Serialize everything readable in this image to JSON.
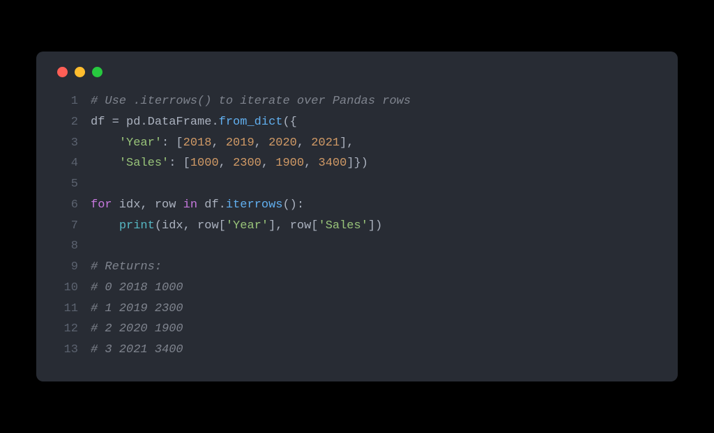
{
  "lines": [
    {
      "n": "1",
      "tokens": [
        {
          "c": "tok-comment",
          "t": "# Use .iterrows() to iterate over Pandas rows"
        }
      ]
    },
    {
      "n": "2",
      "tokens": [
        {
          "c": "tok-name",
          "t": "df "
        },
        {
          "c": "tok-op",
          "t": "= "
        },
        {
          "c": "tok-name",
          "t": "pd"
        },
        {
          "c": "tok-punct",
          "t": "."
        },
        {
          "c": "tok-name",
          "t": "DataFrame"
        },
        {
          "c": "tok-punct",
          "t": "."
        },
        {
          "c": "tok-attr",
          "t": "from_dict"
        },
        {
          "c": "tok-punct",
          "t": "({"
        }
      ]
    },
    {
      "n": "3",
      "tokens": [
        {
          "c": "",
          "t": "    "
        },
        {
          "c": "tok-string",
          "t": "'Year'"
        },
        {
          "c": "tok-punct",
          "t": ": ["
        },
        {
          "c": "tok-number",
          "t": "2018"
        },
        {
          "c": "tok-punct",
          "t": ", "
        },
        {
          "c": "tok-number",
          "t": "2019"
        },
        {
          "c": "tok-punct",
          "t": ", "
        },
        {
          "c": "tok-number",
          "t": "2020"
        },
        {
          "c": "tok-punct",
          "t": ", "
        },
        {
          "c": "tok-number",
          "t": "2021"
        },
        {
          "c": "tok-punct",
          "t": "],"
        }
      ]
    },
    {
      "n": "4",
      "tokens": [
        {
          "c": "",
          "t": "    "
        },
        {
          "c": "tok-string",
          "t": "'Sales'"
        },
        {
          "c": "tok-punct",
          "t": ": ["
        },
        {
          "c": "tok-number",
          "t": "1000"
        },
        {
          "c": "tok-punct",
          "t": ", "
        },
        {
          "c": "tok-number",
          "t": "2300"
        },
        {
          "c": "tok-punct",
          "t": ", "
        },
        {
          "c": "tok-number",
          "t": "1900"
        },
        {
          "c": "tok-punct",
          "t": ", "
        },
        {
          "c": "tok-number",
          "t": "3400"
        },
        {
          "c": "tok-punct",
          "t": "]})"
        }
      ]
    },
    {
      "n": "5",
      "tokens": []
    },
    {
      "n": "6",
      "tokens": [
        {
          "c": "tok-keyword",
          "t": "for"
        },
        {
          "c": "tok-name",
          "t": " idx"
        },
        {
          "c": "tok-punct",
          "t": ", "
        },
        {
          "c": "tok-name",
          "t": "row "
        },
        {
          "c": "tok-keyword",
          "t": "in"
        },
        {
          "c": "tok-name",
          "t": " df"
        },
        {
          "c": "tok-punct",
          "t": "."
        },
        {
          "c": "tok-attr",
          "t": "iterrows"
        },
        {
          "c": "tok-punct",
          "t": "():"
        }
      ]
    },
    {
      "n": "7",
      "tokens": [
        {
          "c": "",
          "t": "    "
        },
        {
          "c": "tok-builtin",
          "t": "print"
        },
        {
          "c": "tok-punct",
          "t": "("
        },
        {
          "c": "tok-name",
          "t": "idx"
        },
        {
          "c": "tok-punct",
          "t": ", "
        },
        {
          "c": "tok-name",
          "t": "row"
        },
        {
          "c": "tok-punct",
          "t": "["
        },
        {
          "c": "tok-string",
          "t": "'Year'"
        },
        {
          "c": "tok-punct",
          "t": "], "
        },
        {
          "c": "tok-name",
          "t": "row"
        },
        {
          "c": "tok-punct",
          "t": "["
        },
        {
          "c": "tok-string",
          "t": "'Sales'"
        },
        {
          "c": "tok-punct",
          "t": "])"
        }
      ]
    },
    {
      "n": "8",
      "tokens": []
    },
    {
      "n": "9",
      "tokens": [
        {
          "c": "tok-comment",
          "t": "# Returns:"
        }
      ]
    },
    {
      "n": "10",
      "tokens": [
        {
          "c": "tok-comment",
          "t": "# 0 2018 1000"
        }
      ]
    },
    {
      "n": "11",
      "tokens": [
        {
          "c": "tok-comment",
          "t": "# 1 2019 2300"
        }
      ]
    },
    {
      "n": "12",
      "tokens": [
        {
          "c": "tok-comment",
          "t": "# 2 2020 1900"
        }
      ]
    },
    {
      "n": "13",
      "tokens": [
        {
          "c": "tok-comment",
          "t": "# 3 2021 3400"
        }
      ]
    }
  ]
}
